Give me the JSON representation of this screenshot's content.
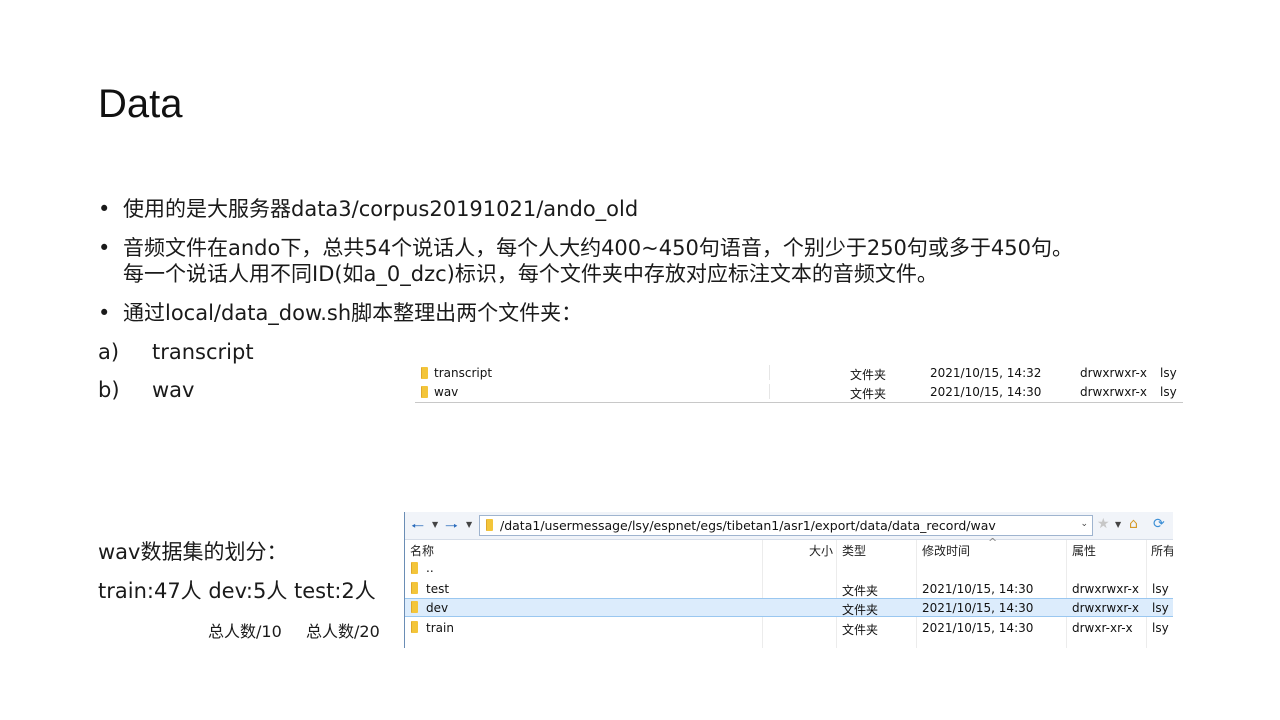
{
  "title": "Data",
  "bullets": [
    {
      "marker": "•",
      "lines": [
        "使用的是大服务器data3/corpus20191021/ando_old"
      ]
    },
    {
      "marker": "•",
      "lines": [
        "音频文件在ando下，总共54个说话人，每个人大约400~450句语音，个别少于250句或多于450句。",
        "每一个说话人用不同ID(如a_0_dzc)标识，每个文件夹中存放对应标注文本的音频文件。"
      ]
    },
    {
      "marker": "•",
      "lines": [
        "通过local/data_dow.sh脚本整理出两个文件夹："
      ]
    }
  ],
  "subitems": [
    {
      "marker": "a)",
      "text": "transcript"
    },
    {
      "marker": "b)",
      "text": "wav"
    }
  ],
  "mini_listing": {
    "rows": [
      {
        "name": "transcript",
        "type": "文件夹",
        "modified": "2021/10/15, 14:32",
        "perms": "drwxrwxr-x",
        "owner": "lsy"
      },
      {
        "name": "wav",
        "type": "文件夹",
        "modified": "2021/10/15, 14:30",
        "perms": "drwxrwxr-x",
        "owner": "lsy"
      }
    ]
  },
  "split": {
    "heading": "wav数据集的划分：",
    "line": "train:47人  dev:5人  test:2人",
    "note_dev": "总人数/10",
    "note_test": "总人数/20"
  },
  "explorer": {
    "back_icon": "arrow-left-icon",
    "forward_icon": "arrow-right-icon",
    "path": "/data1/usermessage/lsy/espnet/egs/tibetan1/asr1/export/data/data_record/wav",
    "columns": {
      "name": "名称",
      "size": "大小",
      "type": "类型",
      "modified": "修改时间",
      "attr": "属性",
      "owner": "所有"
    },
    "parent": "..",
    "rows": [
      {
        "name": "test",
        "type": "文件夹",
        "modified": "2021/10/15, 14:30",
        "perms": "drwxrwxr-x",
        "owner": "lsy",
        "selected": false
      },
      {
        "name": "dev",
        "type": "文件夹",
        "modified": "2021/10/15, 14:30",
        "perms": "drwxrwxr-x",
        "owner": "lsy",
        "selected": true
      },
      {
        "name": "train",
        "type": "文件夹",
        "modified": "2021/10/15, 14:30",
        "perms": "drwxr-xr-x",
        "owner": "lsy",
        "selected": false
      }
    ]
  }
}
